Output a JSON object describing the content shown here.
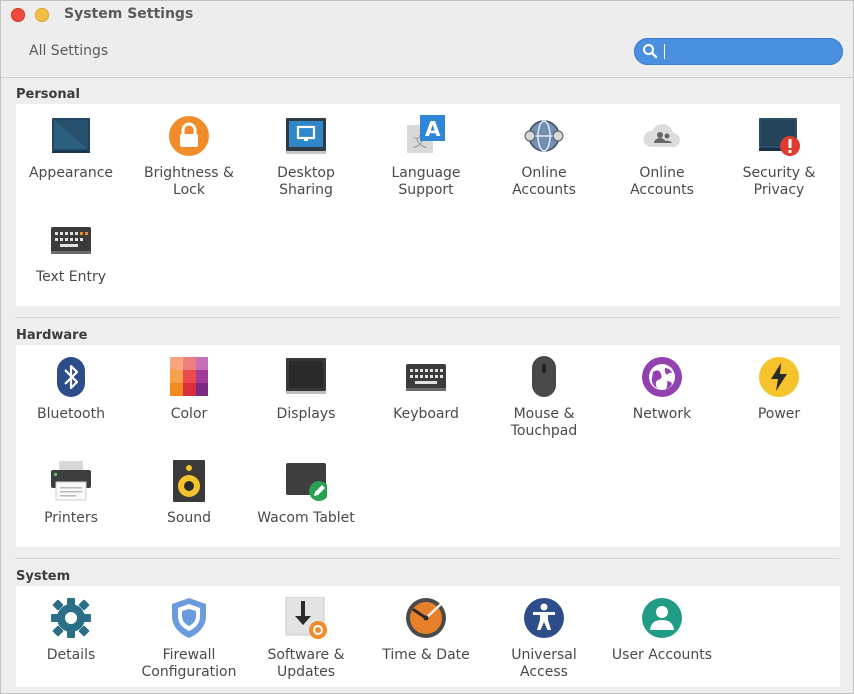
{
  "window": {
    "title": "System Settings"
  },
  "toolbar": {
    "all_settings": "All Settings",
    "search_value": ""
  },
  "sections": {
    "personal": {
      "title": "Personal",
      "items": [
        {
          "label": "Appearance"
        },
        {
          "label": "Brightness &\nLock"
        },
        {
          "label": "Desktop\nSharing"
        },
        {
          "label": "Language\nSupport"
        },
        {
          "label": "Online\nAccounts"
        },
        {
          "label": "Online\nAccounts"
        },
        {
          "label": "Security &\nPrivacy"
        },
        {
          "label": "Text Entry"
        }
      ]
    },
    "hardware": {
      "title": "Hardware",
      "items": [
        {
          "label": "Bluetooth"
        },
        {
          "label": "Color"
        },
        {
          "label": "Displays"
        },
        {
          "label": "Keyboard"
        },
        {
          "label": "Mouse &\nTouchpad"
        },
        {
          "label": "Network"
        },
        {
          "label": "Power"
        },
        {
          "label": "Printers"
        },
        {
          "label": "Sound"
        },
        {
          "label": "Wacom Tablet"
        }
      ]
    },
    "system": {
      "title": "System",
      "items": [
        {
          "label": "Details"
        },
        {
          "label": "Firewall\nConfiguration"
        },
        {
          "label": "Software &\nUpdates"
        },
        {
          "label": "Time & Date"
        },
        {
          "label": "Universal\nAccess"
        },
        {
          "label": "User Accounts"
        }
      ]
    }
  },
  "colors": {
    "search": "#4a8fe0",
    "close": "#ef4b3a",
    "minimize": "#f2be43",
    "accent_orange": "#f08c2a",
    "accent_teal": "#2a7f86"
  }
}
